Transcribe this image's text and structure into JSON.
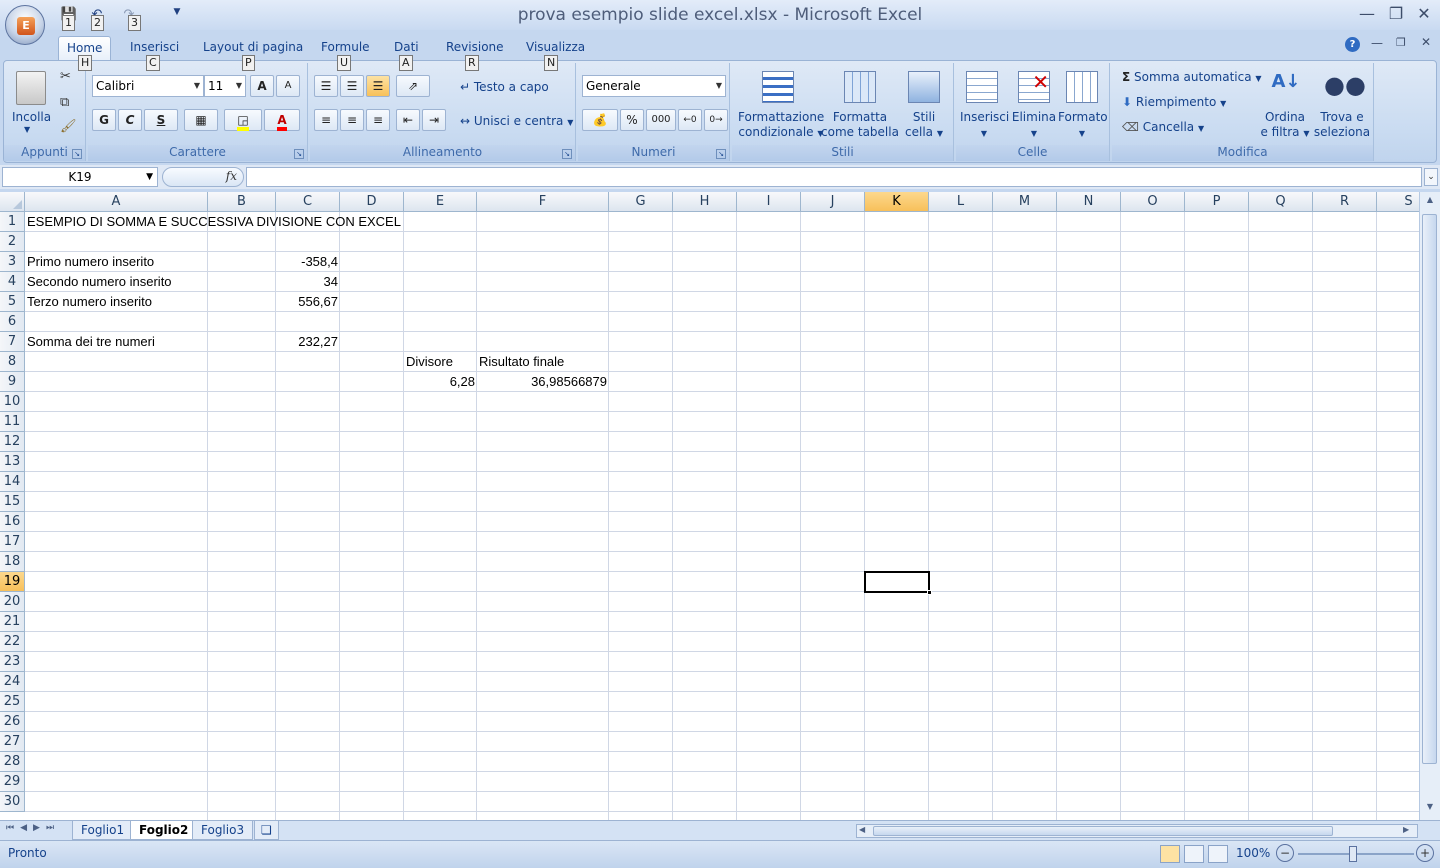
{
  "window": {
    "title": "prova esempio slide excel.xlsx - Microsoft Excel",
    "qat_keytips": [
      "1",
      "2",
      "3"
    ],
    "office_logo": "E"
  },
  "tabs": [
    {
      "label": "Home",
      "keytip": "H"
    },
    {
      "label": "Inserisci",
      "keytip": "C"
    },
    {
      "label": "Layout di pagina",
      "keytip": "P"
    },
    {
      "label": "Formule",
      "keytip": "U"
    },
    {
      "label": "Dati",
      "keytip": "A"
    },
    {
      "label": "Revisione",
      "keytip": "R"
    },
    {
      "label": "Visualizza",
      "keytip": "N"
    }
  ],
  "ribbon": {
    "appunti": {
      "label": "Appunti",
      "paste": "Incolla"
    },
    "carattere": {
      "label": "Carattere",
      "font": "Calibri",
      "size": "11",
      "bold": "G",
      "italic": "C",
      "underline": "S",
      "grow": "A",
      "shrink": "A",
      "font_color": "A"
    },
    "allineamento": {
      "label": "Allineamento",
      "wrap": "Testo a capo",
      "merge": "Unisci e centra"
    },
    "numeri": {
      "label": "Numeri",
      "format": "Generale",
      "percent": "%",
      "thousands": "000"
    },
    "stili": {
      "label": "Stili",
      "cond1": "Formattazione",
      "cond2": "condizionale",
      "table1": "Formatta",
      "table2": "come tabella",
      "cell1": "Stili",
      "cell2": "cella"
    },
    "celle": {
      "label": "Celle",
      "insert": "Inserisci",
      "delete": "Elimina",
      "format": "Formato"
    },
    "modifica": {
      "label": "Modifica",
      "autosum": "Somma automatica",
      "fill": "Riempimento",
      "clear": "Cancella",
      "sort1": "Ordina",
      "sort2": "e filtra",
      "find1": "Trova e",
      "find2": "seleziona",
      "sigma": "Σ"
    }
  },
  "formula_bar": {
    "name_box": "K19",
    "fx": "fx",
    "value": ""
  },
  "columns": [
    "A",
    "B",
    "C",
    "D",
    "E",
    "F",
    "G",
    "H",
    "I",
    "J",
    "K",
    "L",
    "M",
    "N",
    "O",
    "P",
    "Q",
    "R",
    "S"
  ],
  "selected_column": "K",
  "selected_row": 19,
  "rows": [
    "1",
    "2",
    "3",
    "4",
    "5",
    "6",
    "7",
    "8",
    "9",
    "10",
    "11",
    "12",
    "13",
    "14",
    "15",
    "16",
    "17",
    "18",
    "19",
    "20",
    "21",
    "22",
    "23",
    "24",
    "25",
    "26",
    "27",
    "28",
    "29",
    "30"
  ],
  "cells": {
    "A1": "ESEMPIO DI SOMMA E SUCCESSIVA DIVISIONE CON EXCEL",
    "A3": "Primo numero inserito",
    "C3": "-358,4",
    "A4": "Secondo numero inserito",
    "C4": "34",
    "A5": "Terzo numero inserito",
    "C5": "556,67",
    "A7": "Somma dei tre numeri",
    "C7": "232,27",
    "E8": "Divisore",
    "F8": "Risultato finale",
    "E9": "6,28",
    "F9": "36,98566879"
  },
  "sheets": [
    "Foglio1",
    "Foglio2",
    "Foglio3"
  ],
  "active_sheet": "Foglio2",
  "status": {
    "text": "Pronto",
    "zoom": "100%"
  }
}
